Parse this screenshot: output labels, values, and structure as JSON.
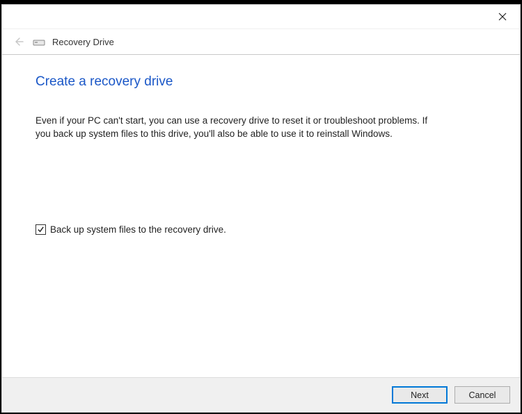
{
  "window": {
    "wizard_name": "Recovery Drive"
  },
  "page": {
    "title": "Create a recovery drive",
    "description": "Even if your PC can't start, you can use a recovery drive to reset it or troubleshoot problems. If you back up system files to this drive, you'll also be able to use it to reinstall Windows."
  },
  "checkbox": {
    "label": "Back up system files to the recovery drive.",
    "checked": true
  },
  "footer": {
    "next_label": "Next",
    "cancel_label": "Cancel"
  }
}
